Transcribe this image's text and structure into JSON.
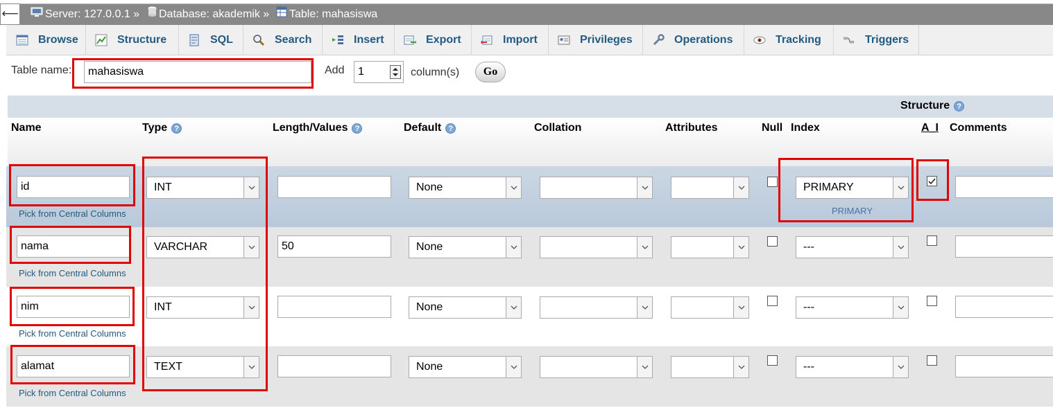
{
  "breadcrumb": {
    "back_glyph": "⟵",
    "server": "Server: 127.0.0.1 »",
    "database": "Database: akademik »",
    "table": "Table: mahasiswa"
  },
  "tabs": [
    {
      "label": "Browse",
      "icon": "browse-icon"
    },
    {
      "label": "Structure",
      "icon": "structure-icon"
    },
    {
      "label": "SQL",
      "icon": "sql-icon"
    },
    {
      "label": "Search",
      "icon": "search-icon"
    },
    {
      "label": "Insert",
      "icon": "insert-icon"
    },
    {
      "label": "Export",
      "icon": "export-icon"
    },
    {
      "label": "Import",
      "icon": "import-icon"
    },
    {
      "label": "Privileges",
      "icon": "privileges-icon"
    },
    {
      "label": "Operations",
      "icon": "wrench-icon"
    },
    {
      "label": "Tracking",
      "icon": "eye-icon"
    },
    {
      "label": "Triggers",
      "icon": "triggers-icon"
    }
  ],
  "table_form": {
    "name_label": "Table name:",
    "name_value": "mahasiswa",
    "add_label": "Add",
    "add_count": "1",
    "columns_label": "column(s)",
    "go_label": "Go"
  },
  "structure_label": "Structure",
  "headers": {
    "name": "Name",
    "type": "Type",
    "length": "Length/Values",
    "default": "Default",
    "collation": "Collation",
    "attributes": "Attributes",
    "null": "Null",
    "index": "Index",
    "ai": "A_I",
    "comments": "Comments"
  },
  "pick_label": "Pick from Central Columns",
  "columns": [
    {
      "name": "id",
      "type": "INT",
      "length": "",
      "default": "None",
      "collation": "",
      "attributes": "",
      "null": false,
      "index": "PRIMARY",
      "index_note": "PRIMARY",
      "ai": true,
      "comments": ""
    },
    {
      "name": "nama",
      "type": "VARCHAR",
      "length": "50",
      "default": "None",
      "collation": "",
      "attributes": "",
      "null": false,
      "index": "---",
      "index_note": "",
      "ai": false,
      "comments": ""
    },
    {
      "name": "nim",
      "type": "INT",
      "length": "",
      "default": "None",
      "collation": "",
      "attributes": "",
      "null": false,
      "index": "---",
      "index_note": "",
      "ai": false,
      "comments": ""
    },
    {
      "name": "alamat",
      "type": "TEXT",
      "length": "",
      "default": "None",
      "collation": "",
      "attributes": "",
      "null": false,
      "index": "---",
      "index_note": "",
      "ai": false,
      "comments": ""
    }
  ],
  "colors": {
    "breadcrumb_bg": "#888888",
    "link": "#235a81",
    "highlight": "#e00000",
    "header_band": "#d6dfe8",
    "row_alt": "#e5e5e5",
    "row_selected": "#cbd7e3"
  }
}
